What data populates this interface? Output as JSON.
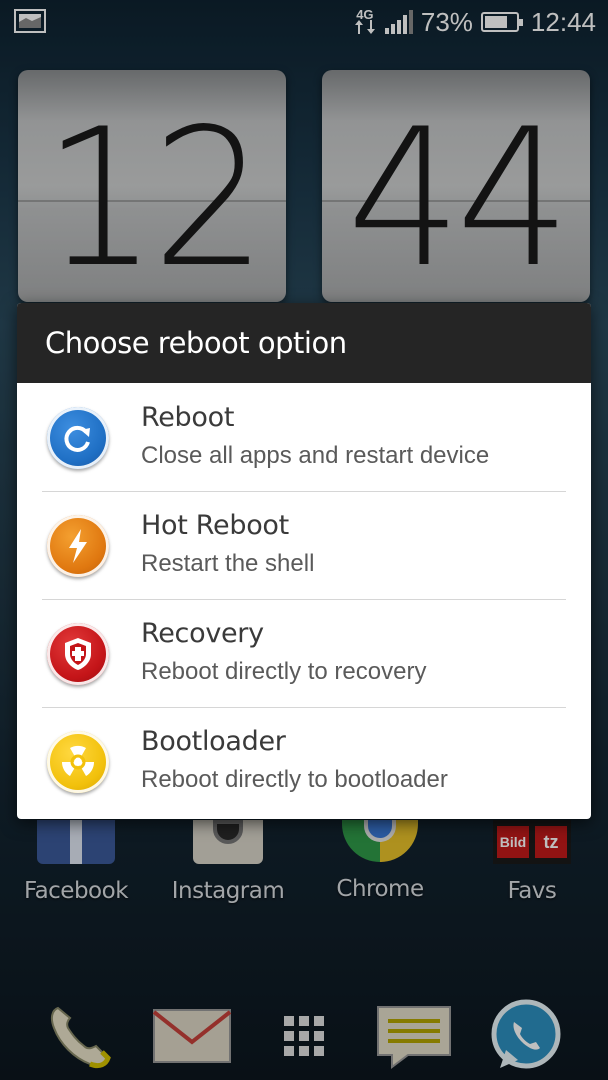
{
  "status_bar": {
    "network_type": "4G",
    "battery_percent": "73%",
    "battery_level": 0.73,
    "time": "12:44"
  },
  "clock_widget": {
    "hours": "12",
    "minutes": "44"
  },
  "dialog": {
    "title": "Choose reboot option",
    "options": [
      {
        "title": "Reboot",
        "subtitle": "Close all apps and restart device",
        "icon": "refresh-icon",
        "color": "#1f6fc4"
      },
      {
        "title": "Hot Reboot",
        "subtitle": "Restart the shell",
        "icon": "lightning-icon",
        "color": "#e07810"
      },
      {
        "title": "Recovery",
        "subtitle": "Reboot directly to recovery",
        "icon": "shield-icon",
        "color": "#c41418"
      },
      {
        "title": "Bootloader",
        "subtitle": "Reboot directly to bootloader",
        "icon": "radiation-icon",
        "color": "#f2c10c"
      }
    ]
  },
  "home_apps": [
    {
      "label": "Facebook",
      "icon": "facebook-icon"
    },
    {
      "label": "Instagram",
      "icon": "instagram-icon"
    },
    {
      "label": "Chrome",
      "icon": "chrome-icon"
    },
    {
      "label": "Favs",
      "icon": "favs-folder-icon"
    }
  ],
  "dock": [
    {
      "icon": "phone-icon"
    },
    {
      "icon": "mail-icon"
    },
    {
      "icon": "app-drawer-icon"
    },
    {
      "icon": "messages-icon"
    },
    {
      "icon": "whatsapp-icon"
    }
  ]
}
